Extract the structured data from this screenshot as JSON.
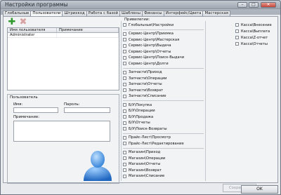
{
  "window": {
    "title": "Настройки программы"
  },
  "tabs": [
    "Глобальные",
    "Пользователи",
    "Штрихкод",
    "Работа с базой",
    "Шаблоны",
    "Финансы",
    "Интерфейс/Цвета",
    "Мастерская"
  ],
  "active_tab": "Пользователи",
  "users_grid": {
    "columns": [
      "Имя пользователя",
      "Примечание"
    ],
    "rows": [
      {
        "name": "Administrator",
        "note": ""
      }
    ]
  },
  "user_form": {
    "section_label": "Пользователь",
    "name_label": "Имя:",
    "password_label": "Пароль:",
    "note_label": "Примечание:",
    "name_value": "",
    "password_value": "",
    "note_value": ""
  },
  "privileges_label": "Привилегии:",
  "privileges_col1": [
    [
      "Глобальные\\Настройки"
    ],
    [
      "Сервис-Центр\\Приемка",
      "Сервис-Центр\\Мастерская",
      "Сервис-Центр\\Выдача",
      "Сервис-Центр\\Отчеты",
      "Сервис-Центр\\Поиск-Выдачи",
      "Сервис-Центр\\Долги"
    ],
    [
      "Запчасти\\Приход",
      "Запчасти\\Операции",
      "Запчасти\\Отчеты",
      "Запчасти\\Возврат",
      "Запчасти\\Списание"
    ],
    [
      "Б/У\\Покупка",
      "Б/У\\Операции",
      "Б/У\\Продажа",
      "Б/У\\Отчеты",
      "Б/У\\Поиск-Возвраты"
    ],
    [
      "Прайс-Лист\\Просмотр",
      "Прайс-Лист\\Редактирование"
    ],
    [
      "Магазин\\Приход",
      "Магазин\\Операции",
      "Магазин\\Отчеты",
      "Магазин\\Возврат",
      "Магазин\\Списание"
    ]
  ],
  "privileges_col2": [
    "Касса\\Внесение",
    "Касса\\Выплата",
    "Касса\\Z-отчет",
    "Касса\\Отчеты"
  ],
  "buttons": {
    "save": "Сохранить",
    "ok": "OK"
  },
  "icons": {
    "add": "plus-icon",
    "delete": "x-icon",
    "user": "user-avatar-icon"
  },
  "colors": {
    "add": "#2e9a2e",
    "delete": "#d8a2a2",
    "avatar": "#3f8ee0"
  }
}
